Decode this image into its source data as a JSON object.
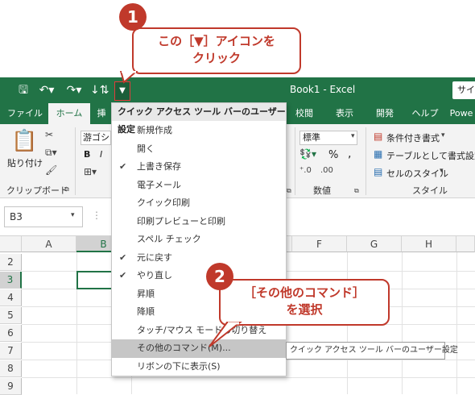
{
  "title_bar": {
    "doc_title": "Book1 - Excel",
    "search_label": "サイ",
    "qat_icons": [
      "save-icon",
      "undo-icon",
      "redo-icon",
      "sort-icon",
      "customize-qat-dropdown-icon"
    ]
  },
  "tabs": [
    "ファイル",
    "ホーム",
    "挿",
    "校閲",
    "表示",
    "開発",
    "ヘルプ",
    "Powe"
  ],
  "ribbon": {
    "paste_label": "貼り付け",
    "clipboard_label": "クリップボード",
    "font_name": "游ゴシッ",
    "bold": "B",
    "italic": "I",
    "number_format": "標準",
    "percent": "%",
    "comma": ",",
    "number_label": "数値",
    "conditional_format": "条件付き書式",
    "format_as_table": "テーブルとして書式設定",
    "cell_styles": "セルのスタイル",
    "styles_label": "スタイル"
  },
  "formula_bar": {
    "name_box": "B3"
  },
  "grid": {
    "columns": [
      "A",
      "B",
      "F",
      "G",
      "H"
    ],
    "rows": [
      "2",
      "3",
      "4",
      "5",
      "6",
      "7",
      "8",
      "9"
    ],
    "selected_cell": "B3"
  },
  "qat_menu": {
    "header": "クイック アクセス ツール バーのユーザー設定",
    "items": [
      {
        "label": "新規作成",
        "checked": false
      },
      {
        "label": "開く",
        "checked": false
      },
      {
        "label": "上書き保存",
        "checked": true
      },
      {
        "label": "電子メール",
        "checked": false
      },
      {
        "label": "クイック印刷",
        "checked": false
      },
      {
        "label": "印刷プレビューと印刷",
        "checked": false
      },
      {
        "label": "スペル チェック",
        "checked": false
      },
      {
        "label": "元に戻す",
        "checked": true
      },
      {
        "label": "やり直し",
        "checked": true
      },
      {
        "label": "昇順",
        "checked": false
      },
      {
        "label": "降順",
        "checked": false
      },
      {
        "label": "タッチ/マウス モードの切り替え",
        "checked": false
      },
      {
        "label": "その他のコマンド(M)...",
        "checked": false,
        "highlighted": true
      },
      {
        "label": "リボンの下に表示(S)",
        "checked": false
      }
    ]
  },
  "tooltip": "クイック アクセス ツール バーのユーザー設定",
  "callouts": {
    "one": {
      "number": "1",
      "line1": "この［▼］アイコンを",
      "line2": "クリック"
    },
    "two": {
      "number": "2",
      "line1": "［その他のコマンド］",
      "line2": "を選択"
    }
  },
  "colors": {
    "accent": "#217346",
    "callout": "#c0392b"
  }
}
